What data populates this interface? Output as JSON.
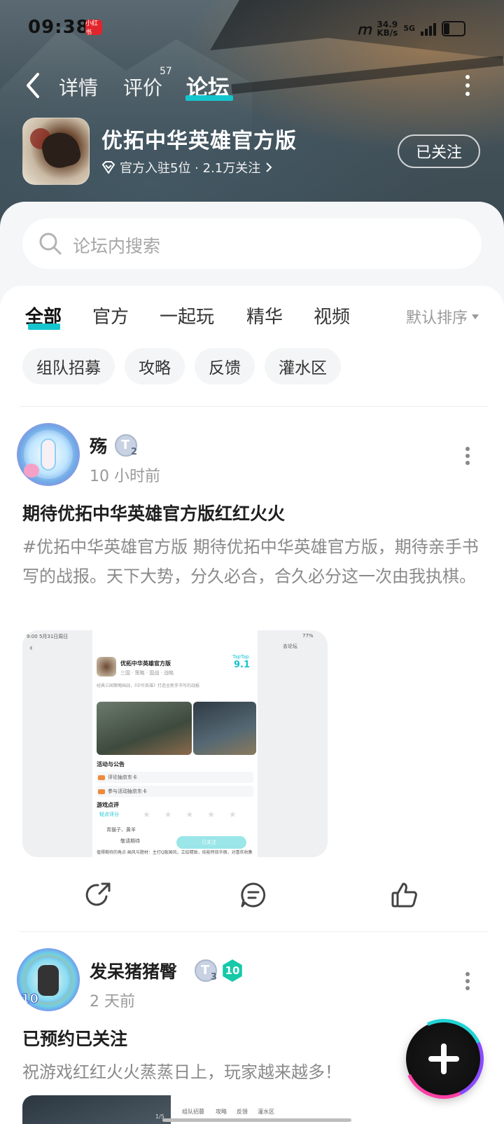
{
  "status_bar": {
    "time": "09:38",
    "app_badge": "小红书",
    "speed_value": "34.9",
    "speed_unit": "KB/s",
    "network": "5G"
  },
  "nav": {
    "tabs": [
      "详情",
      "评价",
      "论坛"
    ],
    "review_count": "57",
    "active_tab": "论坛"
  },
  "app": {
    "name": "优拓中华英雄官方版",
    "meta": "官方入驻5位 · 2.1万关注",
    "follow_label": "已关注"
  },
  "search": {
    "placeholder": "论坛内搜索"
  },
  "filter_tabs": [
    "全部",
    "官方",
    "一起玩",
    "精华",
    "视频"
  ],
  "sort_label": "默认排序",
  "chips": [
    "组队招募",
    "攻略",
    "反馈",
    "灌水区"
  ],
  "posts": [
    {
      "user": "殇",
      "level": "2",
      "time": "10 小时前",
      "title": "期待优拓中华英雄官方版红红火火",
      "body": "#优拓中华英雄官方版 期待优拓中华英雄官方版，期待亲手书写的战报。天下大势，分久必合，合久必分这一次由我执棋。",
      "screenshot": {
        "status_time": "9:00  5月31日周日",
        "battery": "77%",
        "forum_btn": "去论坛",
        "app_name": "优拓中华英雄官方版",
        "tags": "三国 · 策略 · 国战 · 战略",
        "score_label": "TapTap",
        "score": "9.1",
        "desc": "经典三国策略国战，《中华英雄》打造全新手书写的战报",
        "section_events": "活动与公告",
        "event1": "评论抽京东卡",
        "event2": "参与活动抽京东卡",
        "section_reviews": "游戏点评",
        "rate_label": "轻点评分",
        "reviewer": "青猫子、黄羊",
        "btn_left": "敬请期待",
        "btn_right": "已关注",
        "review_text": "值得期待的角点 画风与题材：主打Q版国风，立绘精致，技能特效华丽，对喜欢收集"
      }
    },
    {
      "user": "发呆猪猪臀",
      "level": "3",
      "badge": "10",
      "avatar_text": "10",
      "time": "2 天前",
      "title": "已预约已关注",
      "body": "祝游戏红红火火蒸蒸日上，玩家越来越多！",
      "thumb_tabs": [
        "组队招募",
        "攻略",
        "反馈",
        "灌水区"
      ],
      "thumb_page": "1/5"
    }
  ],
  "colors": {
    "accent": "#15c5ce",
    "level_badge": "#15c9a9"
  }
}
